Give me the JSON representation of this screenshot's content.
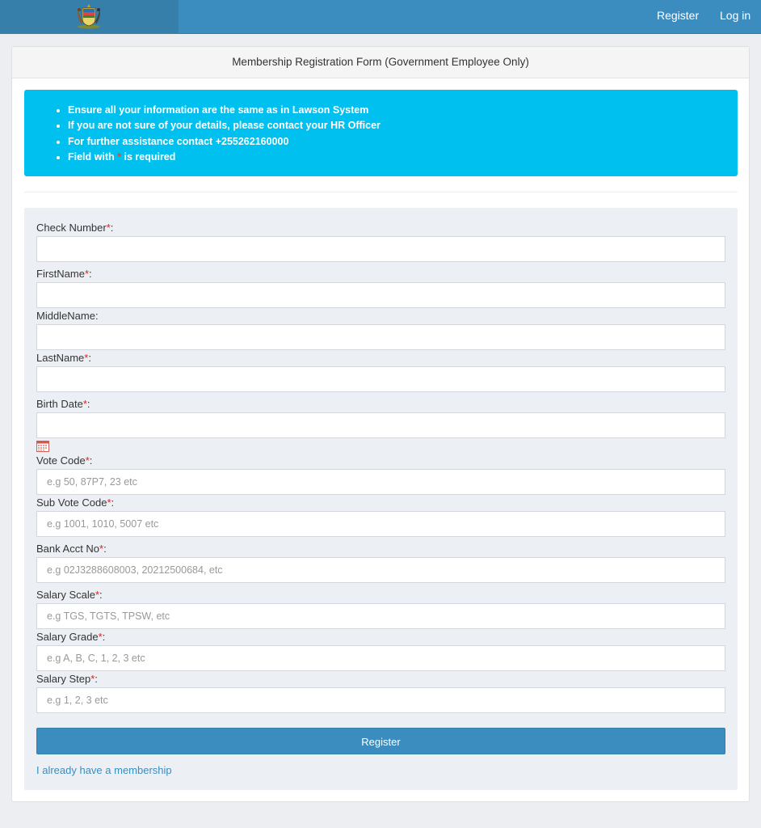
{
  "nav": {
    "register_label": "Register",
    "login_label": "Log in"
  },
  "card": {
    "title": "Membership Registration Form (Government Employee Only)"
  },
  "notice": {
    "items": [
      "Ensure all your information are the same as in Lawson System",
      "If you are not sure of your details, please contact your HR Officer",
      "For further assistance contact +255262160000"
    ],
    "required_prefix": "Field with",
    "required_mark": "*",
    "required_suffix": "is required"
  },
  "form": {
    "check_number": {
      "label": "Check Number",
      "value": ""
    },
    "first_name": {
      "label": "FirstName",
      "value": ""
    },
    "middle_name": {
      "label": "MiddleName:",
      "value": ""
    },
    "last_name": {
      "label": "LastName",
      "value": ""
    },
    "birth_date": {
      "label": "Birth Date",
      "value": ""
    },
    "vote_code": {
      "label": "Vote Code",
      "placeholder": "e.g 50, 87P7, 23 etc"
    },
    "sub_vote_code": {
      "label": "Sub Vote Code",
      "placeholder": "e.g 1001, 1010, 5007 etc"
    },
    "bank_acct": {
      "label": "Bank Acct No",
      "placeholder": "e.g 02J3288608003, 20212500684, etc"
    },
    "salary_scale": {
      "label": "Salary Scale",
      "placeholder": "e.g TGS, TGTS, TPSW, etc"
    },
    "salary_grade": {
      "label": "Salary Grade",
      "placeholder": "e.g A, B, C, 1, 2, 3 etc"
    },
    "salary_step": {
      "label": "Salary Step",
      "placeholder": "e.g 1, 2, 3 etc"
    },
    "required_mark": "*",
    "colon": ":",
    "submit_label": "Register",
    "membership_link": "I already have a membership"
  },
  "colors": {
    "navbar": "#3c8dbf",
    "alert": "#00c0ef",
    "required": "#dd1f1f",
    "link": "#3c8dbc"
  }
}
